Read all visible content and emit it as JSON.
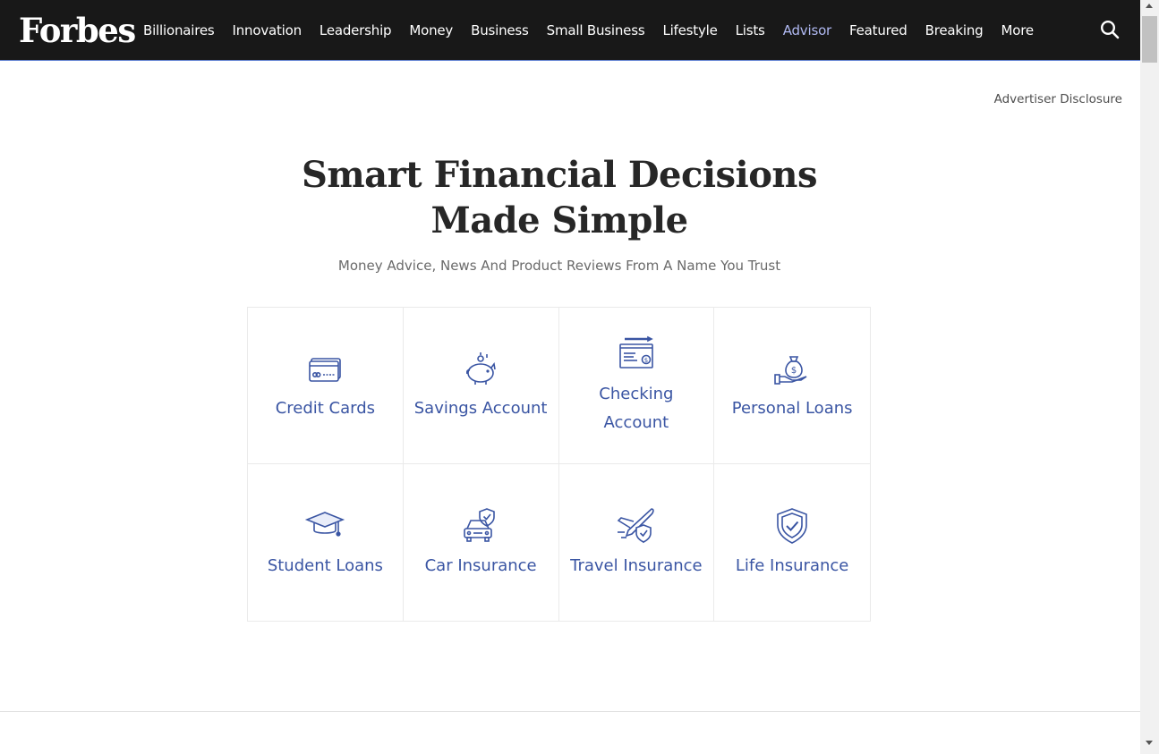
{
  "header": {
    "logo": "Forbes",
    "nav": [
      {
        "label": "Billionaires",
        "active": false
      },
      {
        "label": "Innovation",
        "active": false
      },
      {
        "label": "Leadership",
        "active": false
      },
      {
        "label": "Money",
        "active": false
      },
      {
        "label": "Business",
        "active": false
      },
      {
        "label": "Small Business",
        "active": false
      },
      {
        "label": "Lifestyle",
        "active": false
      },
      {
        "label": "Lists",
        "active": false
      },
      {
        "label": "Advisor",
        "active": true
      },
      {
        "label": "Featured",
        "active": false
      },
      {
        "label": "Breaking",
        "active": false
      },
      {
        "label": "More",
        "active": false
      }
    ],
    "search_icon": "search-icon"
  },
  "disclosure": "Advertiser Disclosure",
  "hero": {
    "title": "Smart Financial Decisions Made Simple",
    "subtitle": "Money Advice, News And Product Reviews From A Name You Trust"
  },
  "categories": [
    {
      "label": "Credit Cards",
      "icon": "credit-card-icon"
    },
    {
      "label": "Savings Account",
      "icon": "piggy-bank-icon"
    },
    {
      "label": "Checking Account",
      "icon": "check-icon"
    },
    {
      "label": "Personal Loans",
      "icon": "money-bag-icon"
    },
    {
      "label": "Student Loans",
      "icon": "graduation-cap-icon"
    },
    {
      "label": "Car Insurance",
      "icon": "car-shield-icon"
    },
    {
      "label": "Travel Insurance",
      "icon": "plane-shield-icon"
    },
    {
      "label": "Life Insurance",
      "icon": "shield-check-icon"
    }
  ],
  "colors": {
    "nav_bg": "#181818",
    "nav_active": "#b0b9f2",
    "accent": "#3a55a3",
    "title": "#272727"
  }
}
